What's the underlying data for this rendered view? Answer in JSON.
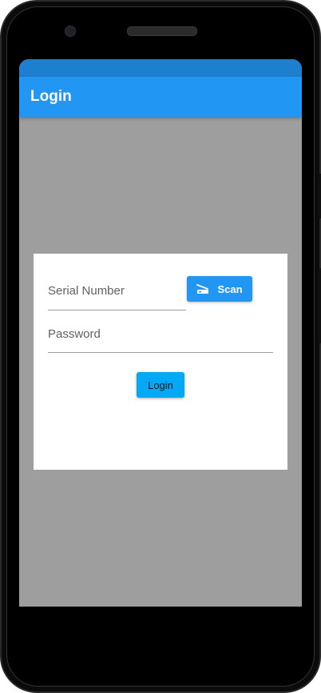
{
  "app_bar": {
    "title": "Login"
  },
  "form": {
    "serial_number": {
      "placeholder": "Serial Number",
      "value": ""
    },
    "password": {
      "placeholder": "Password",
      "value": ""
    },
    "scan_button": {
      "label": "Scan",
      "icon": "scanner-icon"
    },
    "login_button": {
      "label": "Login"
    }
  },
  "colors": {
    "primary": "#2196f3",
    "status_bar": "#1e7fd0",
    "login_button": "#03a9f4",
    "screen_background": "#9e9e9e",
    "card": "#ffffff"
  }
}
